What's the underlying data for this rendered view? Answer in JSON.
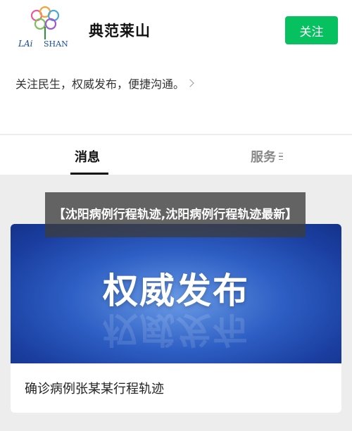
{
  "account": {
    "logo_text": "LAi SHAN",
    "name": "典范莱山",
    "follow_label": "关注",
    "description": "关注民生，权威发布，便捷沟通。"
  },
  "tabs": [
    {
      "label": "消息",
      "active": true
    },
    {
      "label": "服务",
      "active": false
    }
  ],
  "overlay": {
    "text": "【沈阳病例行程轨迹,沈阳病例行程轨迹最新】"
  },
  "article": {
    "banner_text": "权威发布",
    "title": "确诊病例张某某行程轨迹"
  },
  "colors": {
    "accent": "#07c160",
    "banner_blue": "#2e5fc4"
  }
}
